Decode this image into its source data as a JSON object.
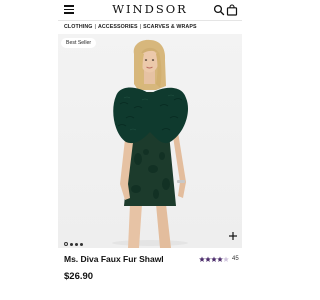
{
  "header": {
    "logo_text": "WINDSOR",
    "menu_icon": "hamburger-menu-icon",
    "search_icon": "search-icon",
    "bag_icon": "shopping-bag-icon"
  },
  "categories": [
    {
      "label": "CLOTHING"
    },
    {
      "label": "ACCESSORIES"
    },
    {
      "label": "SCARVES & WRAPS"
    }
  ],
  "category_separator": "|",
  "image": {
    "badge": "Best Seller",
    "carousel_count": 4,
    "carousel_active": 0,
    "add_icon": "plus-icon",
    "dress_color": "#1c3b2c",
    "shawl_color": "#0f3a2e"
  },
  "product": {
    "title": "Ms. Diva Faux Fur Shawl",
    "rating": 4.5,
    "rating_count": "45",
    "price": "$26.90",
    "star_color": "#4b2c6b"
  }
}
